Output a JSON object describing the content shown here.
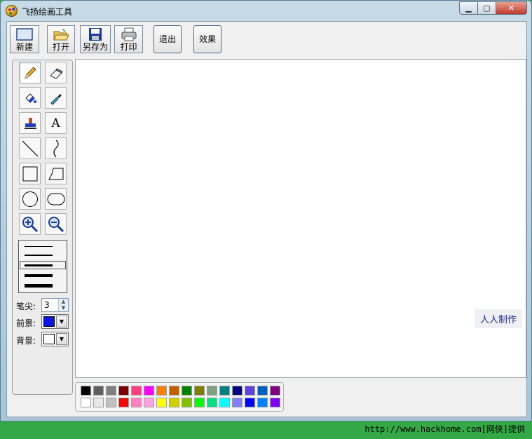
{
  "window": {
    "title": "飞扬绘画工具",
    "min_icon": "minimize-icon",
    "max_icon": "maximize-icon",
    "close_icon": "close-icon"
  },
  "toolbar": {
    "new_label": "新建",
    "open_label": "打开",
    "saveas_label": "另存为",
    "print_label": "打印",
    "exit_label": "退出",
    "effect_label": "效果"
  },
  "tools": [
    {
      "name": "pencil-tool",
      "icon": "pencil-icon"
    },
    {
      "name": "eraser-tool",
      "icon": "eraser-icon"
    },
    {
      "name": "fill-tool",
      "icon": "paint-bucket-icon"
    },
    {
      "name": "color-picker-tool",
      "icon": "eyedropper-icon"
    },
    {
      "name": "stamp-tool",
      "icon": "stamp-icon"
    },
    {
      "name": "text-tool",
      "icon": "text-icon",
      "glyph": "A"
    },
    {
      "name": "line-tool",
      "icon": "line-icon"
    },
    {
      "name": "curve-tool",
      "icon": "curve-icon"
    },
    {
      "name": "rectangle-tool",
      "icon": "rectangle-icon"
    },
    {
      "name": "polygon-tool",
      "icon": "polygon-icon"
    },
    {
      "name": "ellipse-tool",
      "icon": "ellipse-icon"
    },
    {
      "name": "rounded-rect-tool",
      "icon": "rounded-rect-icon"
    },
    {
      "name": "zoom-in-tool",
      "icon": "zoom-in-icon"
    },
    {
      "name": "zoom-out-tool",
      "icon": "zoom-out-icon"
    }
  ],
  "settings": {
    "pen_label": "笔尖:",
    "pen_value": "3",
    "fg_label": "前景:",
    "bg_label": "背景:",
    "fg_color": "#0a14e8",
    "bg_color": "#ffffff"
  },
  "canvas": {
    "credit": "人人制作"
  },
  "palette": {
    "row1": [
      "#000000",
      "#606060",
      "#808080",
      "#800000",
      "#ff4080",
      "#ff00ff",
      "#ff8000",
      "#c06000",
      "#008000",
      "#808000",
      "#80a080",
      "#008080",
      "#000080",
      "#6040e0",
      "#0060c0",
      "#800080"
    ],
    "row2": [
      "#ffffff",
      "#e8e8e8",
      "#c0c0c0",
      "#ff0000",
      "#ff80c0",
      "#ffa0e0",
      "#ffff00",
      "#d0d000",
      "#80c000",
      "#00ff00",
      "#00e080",
      "#00ffff",
      "#8080ff",
      "#0000ff",
      "#0080ff",
      "#8000ff"
    ]
  },
  "watermark": "http://www.hackhome.com[网侠]提供"
}
